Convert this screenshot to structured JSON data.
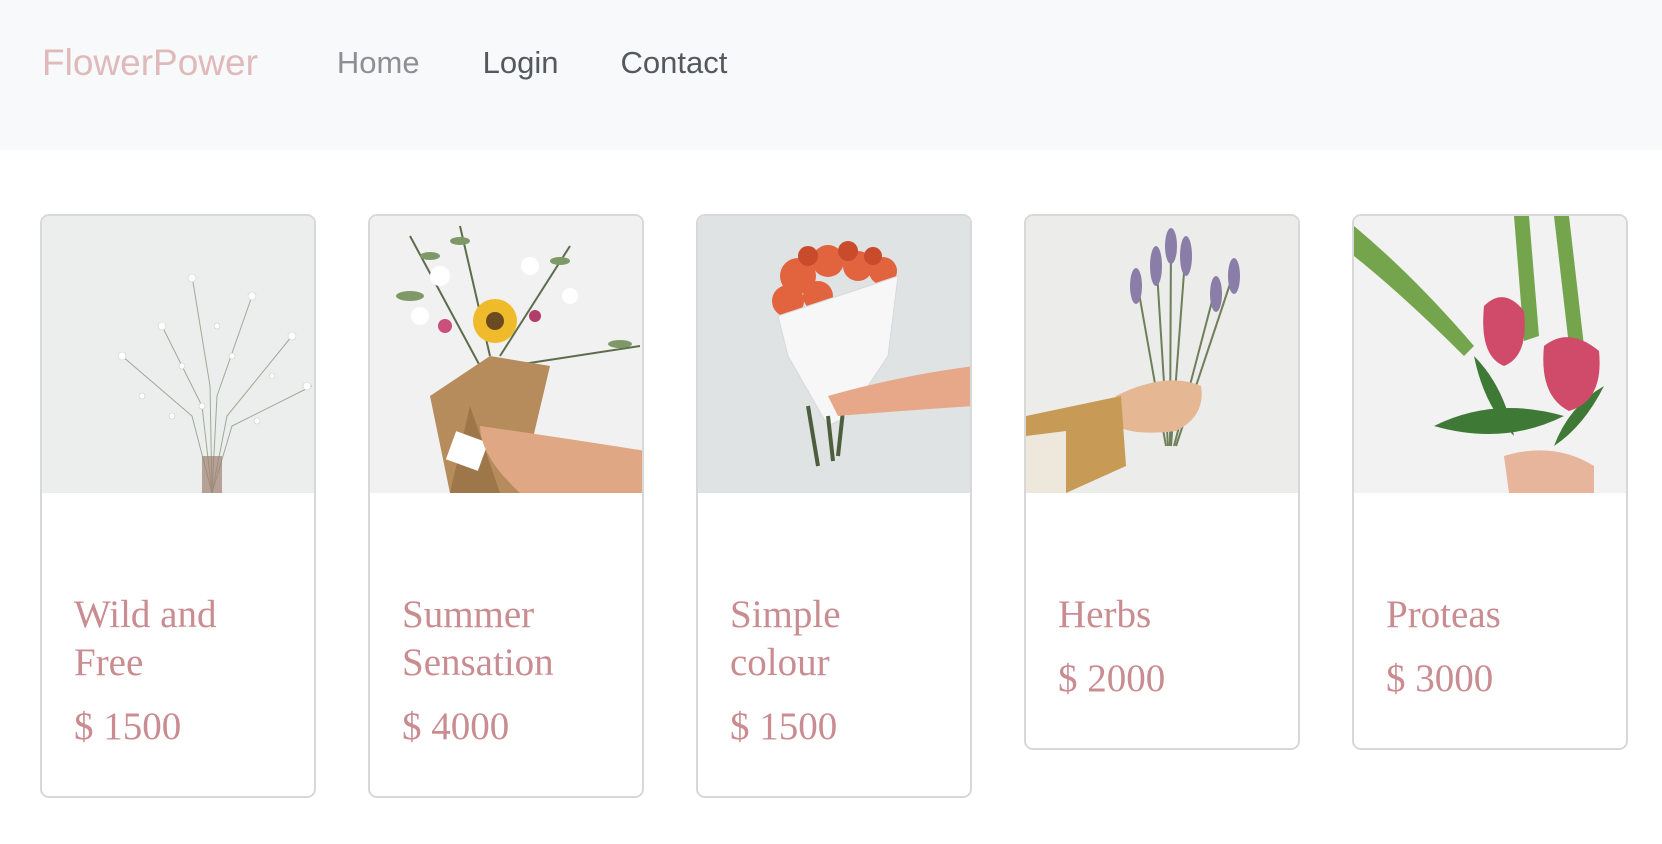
{
  "navbar": {
    "brand": "FlowerPower",
    "links": [
      "Home",
      "Login",
      "Contact"
    ]
  },
  "products": [
    {
      "title": "Wild and Free",
      "price": "$ 1500"
    },
    {
      "title": "Summer Sensation",
      "price": "$ 4000"
    },
    {
      "title": "Simple colour",
      "price": "$ 1500"
    },
    {
      "title": "Herbs",
      "price": "$ 2000"
    },
    {
      "title": "Proteas",
      "price": "$ 3000"
    }
  ]
}
